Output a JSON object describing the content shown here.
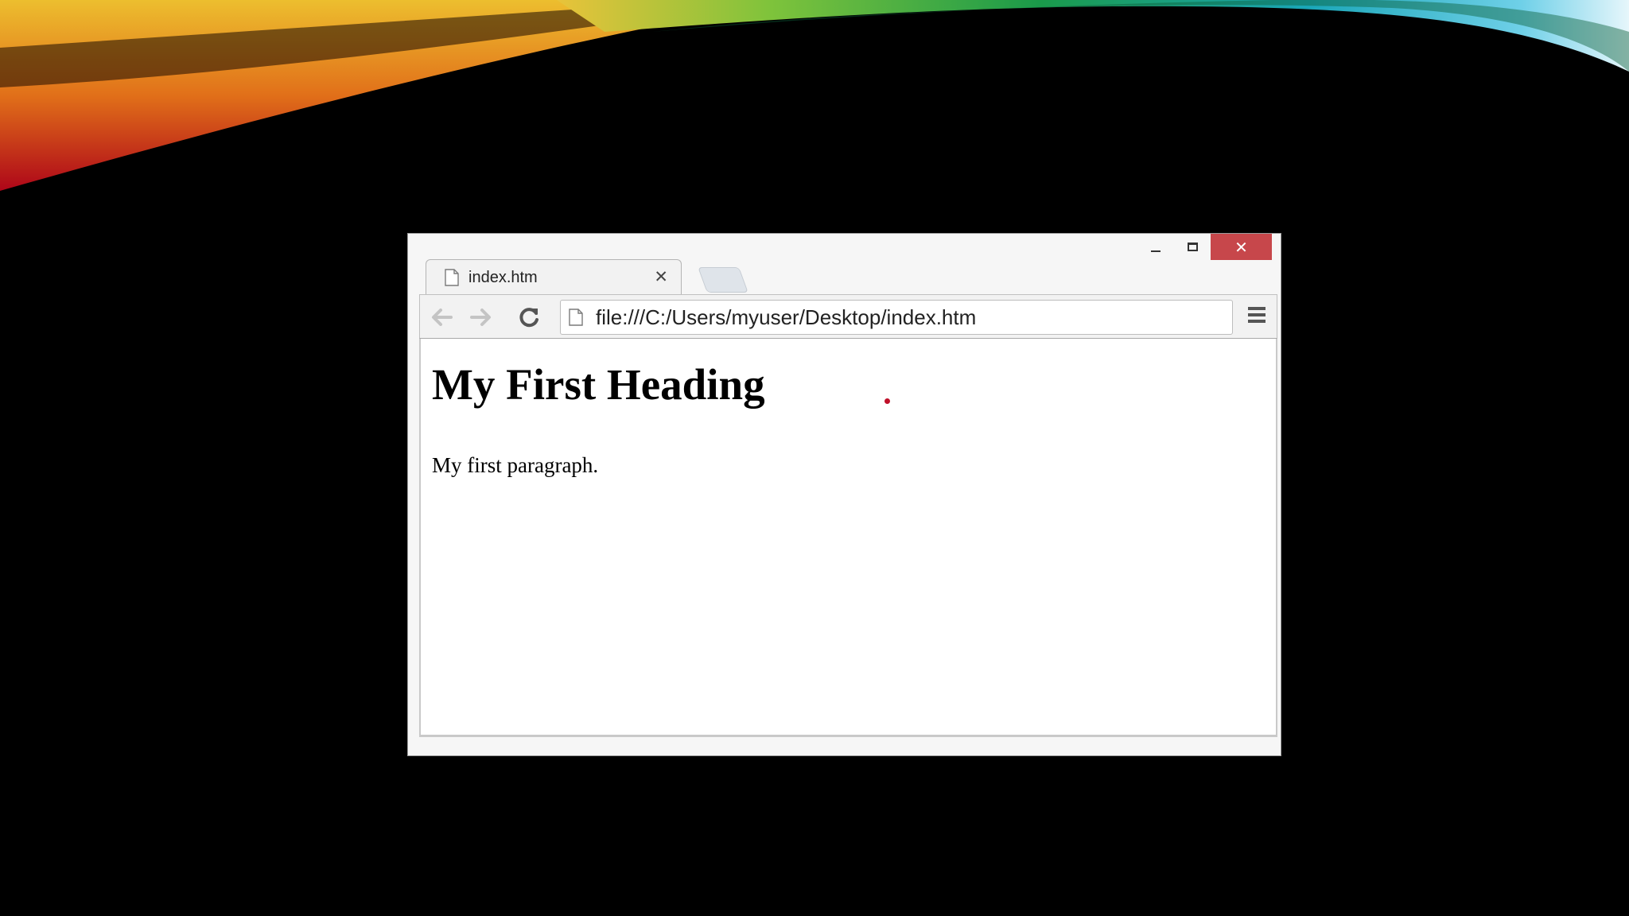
{
  "window": {
    "minimize_icon": "minimize-icon",
    "maximize_icon": "maximize-icon",
    "close_glyph": "✕"
  },
  "tab": {
    "title": "index.htm",
    "close_glyph": "✕"
  },
  "toolbar": {
    "url": "file:///C:/Users/myuser/Desktop/index.htm"
  },
  "page": {
    "heading": "My First Heading",
    "paragraph": "My first paragraph."
  },
  "colors": {
    "close_button": "#c7474b",
    "background": "#000000"
  }
}
